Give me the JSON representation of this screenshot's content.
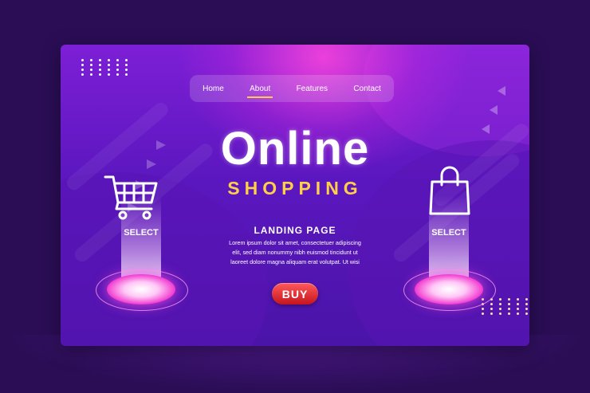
{
  "nav": {
    "items": [
      {
        "label": "Home",
        "active": false
      },
      {
        "label": "About",
        "active": true
      },
      {
        "label": "Features",
        "active": false
      },
      {
        "label": "Contact",
        "active": false
      }
    ]
  },
  "hero": {
    "title": "Online",
    "subtitle": "SHOPPING",
    "section_title": "LANDING PAGE",
    "body_lines": [
      "Lorem ipsum dolor sit amet, consectetuer adipiscing",
      "elit, sed diam nonummy nibh euismod tincidunt ut",
      "laoreet dolore magna aliquam erat volutpat. Ut wisi"
    ],
    "buy_label": "BUY"
  },
  "pedestals": {
    "left": {
      "label": "SELECT",
      "icon": "shopping-cart-icon"
    },
    "right": {
      "label": "SELECT",
      "icon": "shopping-bag-icon"
    }
  },
  "colors": {
    "background": "#2a0d55",
    "accent_yellow": "#ffcf4a",
    "glow_pink": "#f23ad0",
    "buy_red": "#d41a22"
  }
}
